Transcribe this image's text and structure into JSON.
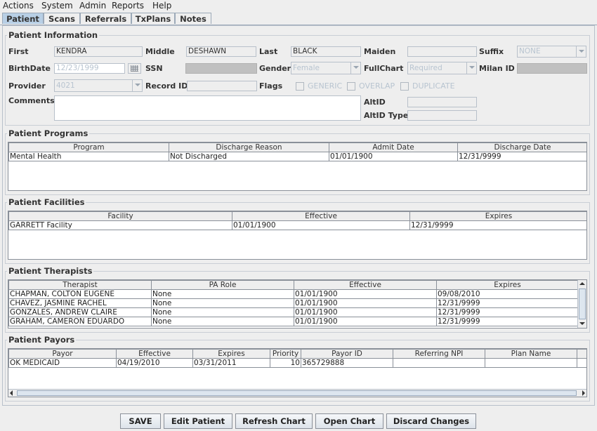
{
  "menu": [
    "Actions",
    "System",
    "Admin",
    "Reports",
    "Help"
  ],
  "tabs": [
    {
      "label": "Patient",
      "active": true
    },
    {
      "label": "Scans",
      "active": false
    },
    {
      "label": "Referrals",
      "active": false
    },
    {
      "label": "TxPlans",
      "active": false
    },
    {
      "label": "Notes",
      "active": false
    }
  ],
  "info": {
    "title": "Patient Information",
    "first_label": "First",
    "first": "KENDRA",
    "middle_label": "Middle",
    "middle": "DESHAWN",
    "last_label": "Last",
    "last": "BLACK",
    "maiden_label": "Maiden",
    "maiden": "",
    "suffix_label": "Suffix",
    "suffix": "NONE",
    "birthdate_label": "BirthDate",
    "birthdate": "12/23/1999",
    "ssn_label": "SSN",
    "gender_label": "Gender",
    "gender": "Female",
    "fullchart_label": "FullChart",
    "fullchart": "Required",
    "milan_label": "Milan ID",
    "provider_label": "Provider",
    "provider": "4021",
    "recordid_label": "Record ID",
    "recordid": "",
    "flags_label": "Flags",
    "flags": [
      "GENERIC",
      "OVERLAP",
      "DUPLICATE"
    ],
    "comments_label": "Comments",
    "comments": "",
    "altid_label": "AltID",
    "altid": "",
    "altidtype_label": "AltID Type",
    "altidtype": ""
  },
  "programs": {
    "title": "Patient Programs",
    "columns": [
      "Program",
      "Discharge Reason",
      "Admit Date",
      "Discharge Date"
    ],
    "rows": [
      [
        "Mental Health",
        "Not Discharged",
        "01/01/1900",
        "12/31/9999"
      ]
    ]
  },
  "facilities": {
    "title": "Patient Facilities",
    "columns": [
      "Facility",
      "Effective",
      "Expires"
    ],
    "rows": [
      [
        "GARRETT Facility",
        "01/01/1900",
        "12/31/9999"
      ]
    ]
  },
  "therapists": {
    "title": "Patient Therapists",
    "columns": [
      "Therapist",
      "PA Role",
      "Effective",
      "Expires"
    ],
    "rows": [
      [
        "CHAPMAN, COLTON EUGENE",
        "None",
        "01/01/1900",
        "09/08/2010"
      ],
      [
        "CHAVEZ, JASMINE RACHEL",
        "None",
        "01/01/1900",
        "12/31/9999"
      ],
      [
        "GONZALES, ANDREW CLAIRE",
        "None",
        "01/01/1900",
        "12/31/9999"
      ],
      [
        "GRAHAM, CAMERON EDUARDO",
        "None",
        "01/01/1900",
        "12/31/9999"
      ]
    ]
  },
  "payors": {
    "title": "Patient Payors",
    "columns": [
      "Payor",
      "Effective",
      "Expires",
      "Priority",
      "Payor ID",
      "Referring NPI",
      "Plan Name"
    ],
    "rows": [
      [
        "OK MEDICAID",
        "04/19/2010",
        "03/31/2011",
        "10",
        "365729888",
        "",
        ""
      ]
    ]
  },
  "buttons": {
    "save": "SAVE",
    "edit": "Edit Patient",
    "refresh": "Refresh Chart",
    "open": "Open Chart",
    "discard": "Discard Changes"
  }
}
